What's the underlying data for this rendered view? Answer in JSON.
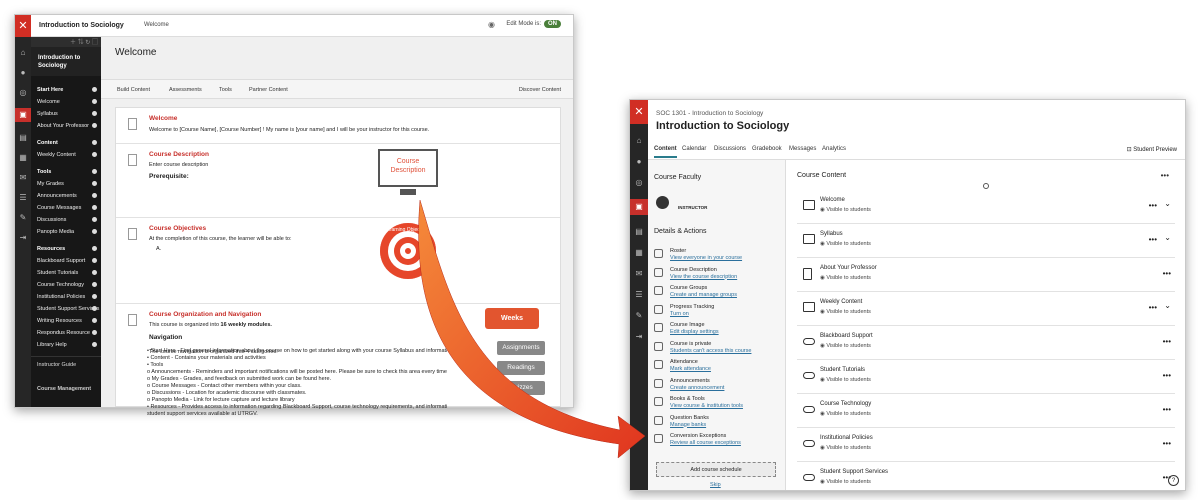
{
  "old_ui": {
    "course_name": "Introduction to Sociology",
    "page": "Welcome",
    "edit_mode_label": "Edit Mode is:",
    "edit_mode_value": "ON",
    "menu_course": "Introduction to Sociology",
    "menu": [
      {
        "section": "Start Here",
        "items": [
          "Welcome",
          "Syllabus",
          "About Your Professor"
        ]
      },
      {
        "section": "Content",
        "items": [
          "Weekly Content"
        ]
      },
      {
        "section": "Tools",
        "items": [
          "My Grades",
          "Announcements",
          "Course Messages",
          "Discussions",
          "Panopto Media"
        ]
      },
      {
        "section": "Resources",
        "items": [
          "Blackboard Support",
          "Student Tutorials",
          "Course Technology",
          "Institutional Policies",
          "Student Support Services",
          "Writing Resources",
          "Respondus Resource",
          "Library Help"
        ]
      }
    ],
    "instructor_guide": "Instructor Guide",
    "course_management": "Course Management",
    "title": "Welcome",
    "toolbar": [
      "Build Content",
      "Assessments",
      "Tools",
      "Partner Content"
    ],
    "discover": "Discover Content",
    "welcome_h": "Welcome",
    "welcome_p": "Welcome to [Course Name], [Course Number] ! My name is [your name] and I will be your instructor for this course.",
    "desc_h": "Course Description",
    "desc_p": "Enter course description",
    "prereq": "Prerequisite:",
    "obj_h": "Course Objectives",
    "obj_p": "At the completion of this course, the learner will be able to:",
    "obj_a": "A.",
    "org_h": "Course Organization and Navigation",
    "org_p": "This course is organized into",
    "org_b": "16 weekly modules.",
    "nav_h": "Navigation",
    "nav_intro": "The course navigation is organized into 4 categories:",
    "nav_lines": [
      "• Start Here - Find general information about the course on how to get started along with your course Syllabus and information about your instructor.",
      "• Content - Contains your materials and activities",
      "• Tools",
      "    o Announcements - Reminders and important notifications will be posted here.  Please be sure to check this area every time you log in.",
      "    o My Grades - Grades, and feedback on submitted work can be found here.",
      "    o Course Messages - Contact other members within your class.",
      "    o Discussions - Location for academic discourse with classmates.",
      "    o Panopto Media - Link for lecture capture and lecture library",
      "• Resources - Provides access to information regarding Blackboard Support, course technology requirements, and information on academic",
      "  student support services available at UTRGV."
    ],
    "ill_desc": "Course Description",
    "ill_obj": "Learning Objectives",
    "weeks": "Weeks",
    "weeks_items": [
      "Assignments",
      "Readings",
      "Quizzes"
    ]
  },
  "new_ui": {
    "course_code": "SOC 1301 - Introduction to Sociology",
    "course_title": "Introduction to Sociology",
    "tabs": [
      "Content",
      "Calendar",
      "Discussions",
      "Gradebook",
      "Messages",
      "Analytics"
    ],
    "student_preview": "Student Preview",
    "faculty": "Course Faculty",
    "instructor": "INSTRUCTOR",
    "details": "Details & Actions",
    "actions": [
      {
        "t": "Roster",
        "l": "View everyone in your course"
      },
      {
        "t": "Course Description",
        "l": "View the course description"
      },
      {
        "t": "Course Groups",
        "l": "Create and manage groups"
      },
      {
        "t": "Progress Tracking",
        "l": "Turn on"
      },
      {
        "t": "Course Image",
        "l": "Edit display settings"
      },
      {
        "t": "Course is private",
        "l": "Students can't access this course"
      },
      {
        "t": "Attendance",
        "l": "Mark attendance"
      },
      {
        "t": "Announcements",
        "l": "Create announcement"
      },
      {
        "t": "Books & Tools",
        "l": "View course & institution tools"
      },
      {
        "t": "Question Banks",
        "l": "Manage banks"
      },
      {
        "t": "Conversion Exceptions",
        "l": "Review all course exceptions"
      }
    ],
    "add_schedule": "Add course schedule",
    "skip": "Skip",
    "content_h": "Course Content",
    "items": [
      {
        "t": "Welcome",
        "v": "Visible to students"
      },
      {
        "t": "Syllabus",
        "v": "Visible to students"
      },
      {
        "t": "About Your Professor",
        "v": "Visible to students"
      },
      {
        "t": "Weekly Content",
        "v": "Visible to students"
      },
      {
        "t": "Blackboard Support",
        "v": "Visible to students"
      },
      {
        "t": "Student Tutorials",
        "v": "Visible to students"
      },
      {
        "t": "Course Technology",
        "v": "Visible to students"
      },
      {
        "t": "Institutional Policies",
        "v": "Visible to students"
      },
      {
        "t": "Student Support Services",
        "v": "Visible to students"
      }
    ]
  }
}
